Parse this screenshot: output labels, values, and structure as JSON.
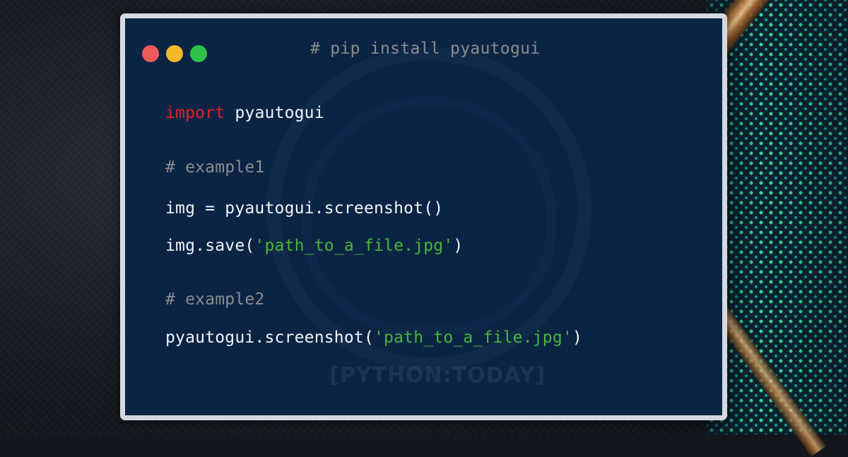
{
  "window": {
    "install_comment": "# pip install pyautogui"
  },
  "code": {
    "line1": {
      "keyword": "import",
      "text": " pyautogui"
    },
    "comment1": "# example1",
    "line2": "img = pyautogui.screenshot()",
    "line3": {
      "prefix": "img.save(",
      "string": "'path_to_a_file.jpg'",
      "suffix": ")"
    },
    "comment2": "# example2",
    "line4": {
      "prefix": "pyautogui.screenshot(",
      "string": "'path_to_a_file.jpg'",
      "suffix": ")"
    }
  },
  "watermark": {
    "brand": "[PYTHON:TODAY]"
  },
  "colors": {
    "window_bg": "#0b2444",
    "window_border": "#d4d9e0",
    "keyword": "#e0242e",
    "string": "#47b83a",
    "comment": "#8c8c8c",
    "text": "#f2f4f7",
    "dot_red": "#ee5a5a",
    "dot_yellow": "#f2b92b",
    "dot_green": "#2fc24a"
  }
}
